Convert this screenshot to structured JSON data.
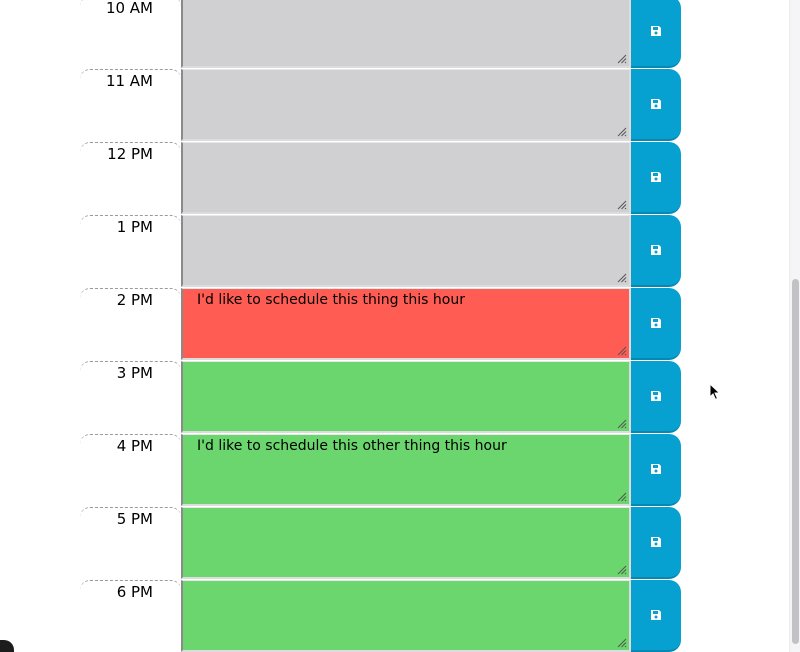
{
  "colors": {
    "past": "#d0cfd1",
    "present": "#ff5c54",
    "future": "#6bd66d",
    "save_button": "#06a0d1"
  },
  "icons": {
    "save": "floppy-disk-icon",
    "cursor": "mouse-pointer-icon"
  },
  "rows": [
    {
      "hour": "10 AM",
      "text": "",
      "state": "past"
    },
    {
      "hour": "11 AM",
      "text": "",
      "state": "past"
    },
    {
      "hour": "12 PM",
      "text": "",
      "state": "past"
    },
    {
      "hour": "1 PM",
      "text": "",
      "state": "past"
    },
    {
      "hour": "2 PM",
      "text": "I'd like to schedule this thing this hour",
      "state": "present"
    },
    {
      "hour": "3 PM",
      "text": "",
      "state": "future"
    },
    {
      "hour": "4 PM",
      "text": "I'd like to schedule this other thing this hour",
      "state": "future"
    },
    {
      "hour": "5 PM",
      "text": "",
      "state": "future"
    },
    {
      "hour": "6 PM",
      "text": "",
      "state": "future"
    }
  ]
}
